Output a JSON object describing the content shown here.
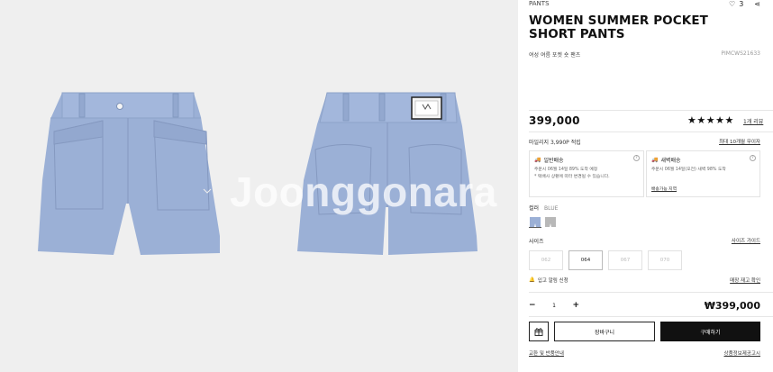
{
  "gallery": {
    "watermark": "Joonggonara"
  },
  "product": {
    "category": "PANTS",
    "title_line1": "WOMEN SUMMER POCKET",
    "title_line2": "SHORT PANTS",
    "subtitle": "여성 여름 포켓 숏 팬츠",
    "code": "PIMCWS21633",
    "likes": "3",
    "price": "399,000",
    "stars": "★★★★★",
    "reviews": "1개 리뷰",
    "points": "마일리지 3,990P 적립",
    "points_link": "최대 10개월 무이자"
  },
  "shipping": {
    "standard_title": "일반배송",
    "standard_text_1": "주문시 06월 14일 89% 도착 예정",
    "standard_text_2": "* 택배사 상황에 따라 변경될 수 있습니다.",
    "dawn_title": "새벽배송",
    "dawn_text": "주문시 06월 14일(오전) 새벽 98% 도착",
    "dawn_link": "배송가능 지역"
  },
  "color": {
    "label": "컬러",
    "value": "BLUE",
    "swatches": [
      "#9bb0d6",
      "#b8b8b8"
    ]
  },
  "size": {
    "label": "사이즈",
    "guide": "사이즈 가이드",
    "options": [
      {
        "label": "062",
        "available": false
      },
      {
        "label": "064",
        "available": true
      },
      {
        "label": "067",
        "available": false
      },
      {
        "label": "070",
        "available": false
      }
    ]
  },
  "restock": {
    "label": "입고 알림 신청",
    "link": "매장 재고 확인"
  },
  "quantity": {
    "minus": "−",
    "value": "1",
    "plus": "+"
  },
  "total": "₩399,000",
  "buttons": {
    "cart": "장바구니",
    "buy": "구매하기"
  },
  "footer": {
    "left": "교환 및 반품안내",
    "right": "상품정보제공고시"
  }
}
